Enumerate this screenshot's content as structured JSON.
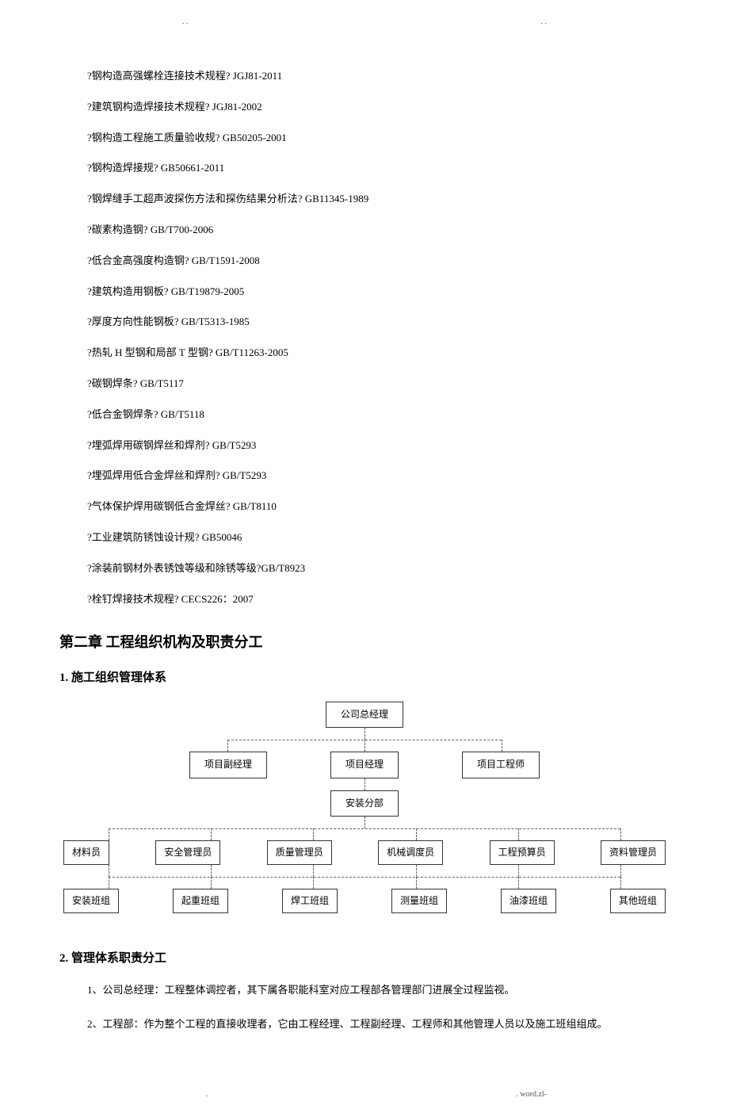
{
  "header_left": ". .",
  "header_right": ". .",
  "specs": [
    "?钢构造高强螺栓连接技术规程?    JGJ81-2011",
    "?建筑钢构造焊接技术规程?    JGJ81-2002",
    "?钢构造工程施工质量验收规?    GB50205-2001",
    "?钢构造焊接规?    GB50661-2011",
    "?钢焊缝手工超声波探伤方法和探伤结果分析法?    GB11345-1989",
    "?碳素构造钢?    GB/T700-2006",
    "?低合金高强度构造钢?    GB/T1591-2008",
    "?建筑构造用钢板?    GB/T19879-2005",
    "?厚度方向性能钢板?    GB/T5313-1985",
    "?热轧 H 型钢和局部 T 型钢?    GB/T11263-2005",
    "?碳钢焊条?    GB/T5117",
    "?低合金钢焊条?    GB/T5118",
    "?埋弧焊用碳钢焊丝和焊剂?    GB/T5293",
    "?埋弧焊用低合金焊丝和焊剂?    GB/T5293",
    "?气体保护焊用碳钢低合金焊丝?    GB/T8110",
    "?工业建筑防锈蚀设计规?    GB50046",
    "?涂装前钢材外表锈蚀等级和除锈等级?GB/T8923",
    "?栓钉焊接技术规程? CECS226：2007"
  ],
  "heading1": "第二章    工程组织机构及职责分工",
  "heading2_1": "1.  施工组织管理体系",
  "heading2_2": "2.  管理体系职责分工",
  "org": {
    "l1": "公司总经理",
    "l2": [
      "项目副经理",
      "项目经理",
      "项目工程师"
    ],
    "l3": "安装分部",
    "l4": [
      "材料员",
      "安全管理员",
      "质量管理员",
      "机械调度员",
      "工程预算员",
      "资料管理员"
    ],
    "l5": [
      "安装班组",
      "起重班组",
      "焊工班组",
      "测量班组",
      "油漆班组",
      "其他班组"
    ]
  },
  "body": {
    "p1": "1、公司总经理：工程整体调控者，其下属各职能科室对应工程部各管理部门进展全过程监视。",
    "p2": "2、工程部：作为整个工程的直接收理者，它由工程经理、工程副经理、工程师和其他管理人员以及施工班组组成。"
  },
  "footer_left": ".",
  "footer_right": ". word.zl-"
}
